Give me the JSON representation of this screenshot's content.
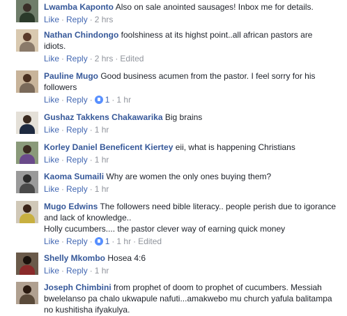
{
  "labels": {
    "like": "Like",
    "reply": "Reply",
    "dot": "·"
  },
  "comments": [
    {
      "name": "Lwamba Kaponto",
      "text": "Also on sale anointed sausages! Inbox me for details.",
      "time": "2 hrs",
      "edited": "",
      "reactions": ""
    },
    {
      "name": "Nathan Chindongo",
      "text": "foolshiness at its highst point..all african pastors are idiots.",
      "time": "2 hrs",
      "edited": "Edited",
      "reactions": ""
    },
    {
      "name": "Pauline Mugo",
      "text": "Good business acumen from the pastor. I feel sorry for his followers",
      "time": "1 hr",
      "edited": "",
      "reactions": "1"
    },
    {
      "name": "Gushaz Takkens Chakawarika",
      "text": "Big brains",
      "time": "1 hr",
      "edited": "",
      "reactions": ""
    },
    {
      "name": "Korley Daniel Beneficent Kiertey",
      "text": "eii, what is happening Christians",
      "time": "1 hr",
      "edited": "",
      "reactions": ""
    },
    {
      "name": "Kaoma Sumaili",
      "text": "Why are women the only ones buying them?",
      "time": "1 hr",
      "edited": "",
      "reactions": ""
    },
    {
      "name": "Mugo Edwins",
      "text": "The followers need bible literacy.. people perish due to igorance and lack of knowledge..",
      "text2": "Holly cucumbers.... the pastor clever way of earning quick money",
      "time": "1 hr",
      "edited": "Edited",
      "reactions": "1"
    },
    {
      "name": "Shelly Mkombo",
      "text": "Hosea 4:6",
      "time": "1 hr",
      "edited": "",
      "reactions": ""
    },
    {
      "name": "Joseph Chimbini",
      "text": "from prophet of doom to prophet of cucumbers. Messiah bwelelanso pa chalo ukwapule nafuti...amakwebo mu church yafula balitampa no kushitisha ifyakulya.",
      "time": "",
      "edited": "",
      "reactions": ""
    }
  ],
  "colors": {
    "name": "#365899",
    "link": "#4267b2",
    "meta": "#90949c",
    "text": "#1d2129",
    "reaction": "#5890ff"
  }
}
